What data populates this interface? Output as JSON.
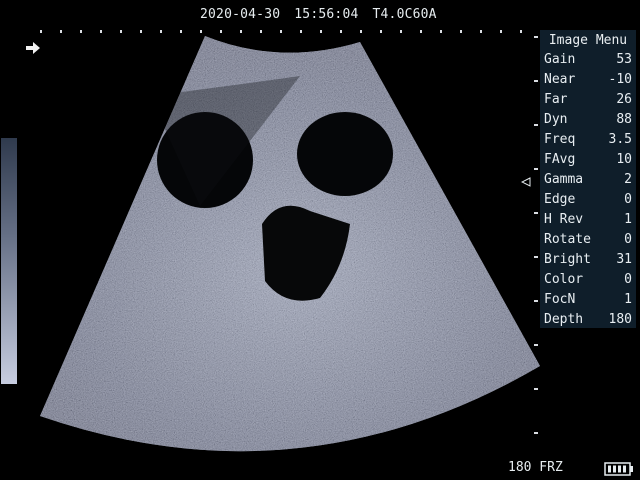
{
  "top_bar": {
    "date": "2020-04-30",
    "time": "15:56:04",
    "probe": "T4.0C60A"
  },
  "menu": {
    "title": "Image Menu",
    "items": [
      {
        "label": "Gain",
        "value": "53"
      },
      {
        "label": "Near",
        "value": "-10"
      },
      {
        "label": "Far",
        "value": "26"
      },
      {
        "label": "Dyn",
        "value": "88"
      },
      {
        "label": "Freq",
        "value": "3.5"
      },
      {
        "label": "FAvg",
        "value": "10"
      },
      {
        "label": "Gamma",
        "value": "2"
      },
      {
        "label": "Edge",
        "value": "0"
      },
      {
        "label": "H Rev",
        "value": "1"
      },
      {
        "label": "Rotate",
        "value": "0"
      },
      {
        "label": "Bright",
        "value": "31"
      },
      {
        "label": "Color",
        "value": "0"
      },
      {
        "label": "FocN",
        "value": "1"
      },
      {
        "label": "Depth",
        "value": "180"
      }
    ]
  },
  "bottom_bar": {
    "status": "180 FRZ"
  },
  "icons": {
    "direction": "arrow-right-icon",
    "focus": "focus-triangle-icon",
    "battery": "battery-icon"
  },
  "colors": {
    "background": "#000000",
    "menu_background": "#0f1e2a",
    "text": "#e8eef2"
  }
}
